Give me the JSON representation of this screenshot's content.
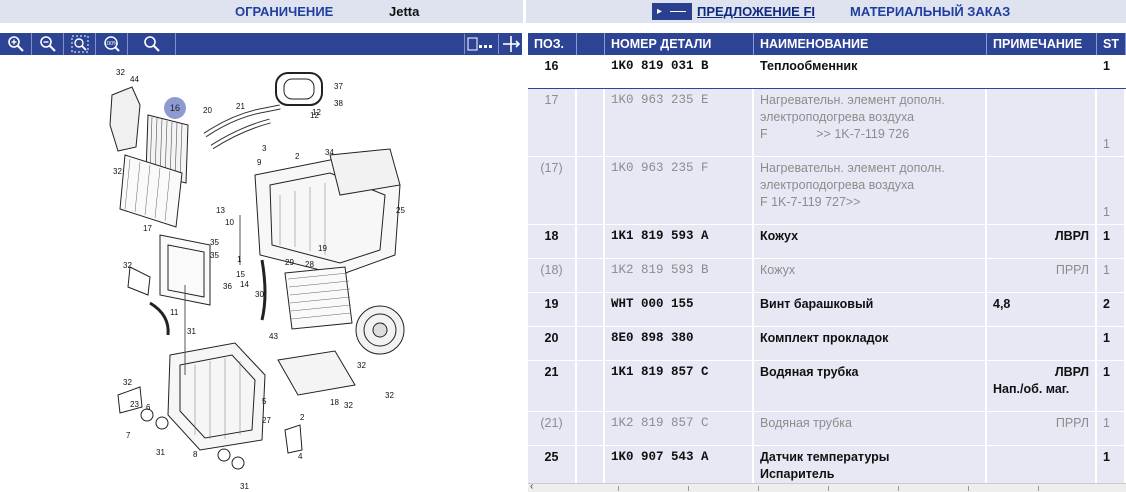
{
  "topbar": {
    "limit_label": "ОГРАНИЧЕНИЕ",
    "model": "Jetta",
    "offer_label": "ПРЕДЛОЖЕНИЕ FI",
    "material_order_label": "МАТЕРИАЛЬНЫЙ ЗАКАЗ"
  },
  "toolbar": {
    "tools": [
      "zoom-in-icon",
      "zoom-out-icon",
      "zoom-area-icon",
      "zoom-100-icon",
      "search-icon"
    ],
    "zoom_100_label": "100%"
  },
  "table": {
    "columns": [
      "ПОЗ.",
      "",
      "НОМЕР ДЕТАЛИ",
      "НАИМЕНОВАНИЕ",
      "ПРИМЕЧАНИЕ",
      "ST"
    ],
    "rows": [
      {
        "pos": "16",
        "num": "1K0 819 031 B",
        "name": "Теплообменник",
        "name2": "",
        "name3": "",
        "note": "",
        "note2": "",
        "st": "1"
      },
      {
        "pos": "17",
        "num": "1K0 963 235 E",
        "name": "Нагревательн. элемент дополн.",
        "name2": "электроподогрева воздуха",
        "name3": "F              >> 1K-7-119 726",
        "note": "",
        "note2": "",
        "st": "1"
      },
      {
        "pos": "(17)",
        "num": "1K0 963 235 F",
        "name": "Нагревательн. элемент дополн.",
        "name2": "электроподогрева воздуха",
        "name3": "F 1K-7-119 727>>",
        "note": "",
        "note2": "",
        "st": "1"
      },
      {
        "pos": "18",
        "num": "1K1 819 593 A",
        "name": "Кожух",
        "name2": "",
        "name3": "",
        "note": "ЛВРЛ",
        "note2": "",
        "st": "1"
      },
      {
        "pos": "(18)",
        "num": "1K2 819 593 B",
        "name": "Кожух",
        "name2": "",
        "name3": "",
        "note": "ПРРЛ",
        "note2": "",
        "st": "1"
      },
      {
        "pos": "19",
        "num": "WHT 000 155",
        "name": "Винт барашковый",
        "name2": "",
        "name3": "",
        "note": "4,8",
        "note2": "",
        "st": "2"
      },
      {
        "pos": "20",
        "num": "8E0 898 380",
        "name": "Комплект прокладок",
        "name2": "",
        "name3": "",
        "note": "",
        "note2": "",
        "st": "1"
      },
      {
        "pos": "21",
        "num": "1K1 819 857 C",
        "name": "Водяная трубка",
        "name2": "",
        "name3": "",
        "note": "ЛВРЛ",
        "note2": "Нап./об. маг.",
        "st": "1"
      },
      {
        "pos": "(21)",
        "num": "1K2 819 857 C",
        "name": "Водяная трубка",
        "name2": "",
        "name3": "",
        "note": "ПРРЛ",
        "note2": "",
        "st": "1"
      },
      {
        "pos": "25",
        "num": "1K0 907 543 A",
        "name": "Датчик температуры",
        "name2": "Испаритель",
        "name3": "",
        "note": "",
        "note2": "",
        "st": "1"
      }
    ]
  },
  "diagram": {
    "callouts": [
      "32",
      "44",
      "16",
      "20",
      "21",
      "37",
      "38",
      "12",
      "2",
      "34",
      "32",
      "17",
      "13",
      "10",
      "9",
      "35",
      "35",
      "1",
      "32",
      "15",
      "14",
      "30",
      "29",
      "19",
      "28",
      "36",
      "31",
      "11",
      "43",
      "32",
      "32",
      "32",
      "23",
      "7",
      "6",
      "31",
      "8",
      "5",
      "27",
      "2",
      "4",
      "18",
      "32",
      "31",
      "25",
      "3",
      "12"
    ]
  }
}
